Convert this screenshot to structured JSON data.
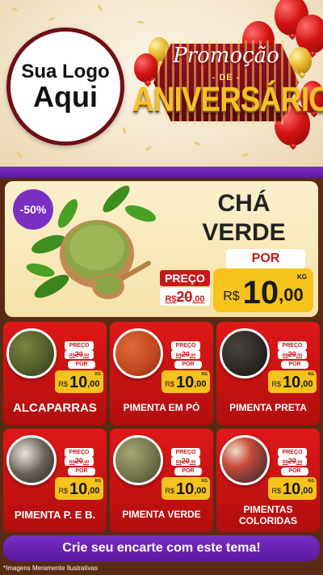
{
  "header": {
    "logo_line1": "Sua Logo",
    "logo_line2": "Aqui",
    "promo_title": "Promoção",
    "promo_de": "- DE -",
    "promo_big": "ANIVERSÁRIO"
  },
  "featured": {
    "badge": "-50%",
    "name_line1": "CHÁ",
    "name_line2": "VERDE",
    "price_label": "PREÇO",
    "por_label": "POR",
    "old_currency": "R$",
    "old_int": "20",
    "old_dec": ",00",
    "new_currency": "R$",
    "new_int": "10",
    "new_dec": ",00",
    "unit": "KG"
  },
  "products": [
    {
      "name": "ALCAPARRAS",
      "price_label": "PREÇO",
      "por_label": "POR",
      "old_currency": "R$",
      "old_int": "20",
      "old_dec": ",00",
      "new_currency": "R$",
      "new_int": "10",
      "new_dec": ",00",
      "unit": "KG",
      "color": "#4f5a2a"
    },
    {
      "name": "PIMENTA EM PÓ",
      "price_label": "PREÇO",
      "por_label": "POR",
      "old_currency": "R$",
      "old_int": "20",
      "old_dec": ",00",
      "new_currency": "R$",
      "new_int": "10",
      "new_dec": ",00",
      "unit": "KG",
      "color": "#c0461e"
    },
    {
      "name": "PIMENTA PRETA",
      "price_label": "PREÇO",
      "por_label": "POR",
      "old_currency": "R$",
      "old_int": "20",
      "old_dec": ",00",
      "new_currency": "R$",
      "new_int": "10",
      "new_dec": ",00",
      "unit": "KG",
      "color": "#2a2622"
    },
    {
      "name": "PIMENTA P. E B.",
      "price_label": "PREÇO",
      "por_label": "POR",
      "old_currency": "R$",
      "old_int": "20",
      "old_dec": ",00",
      "new_currency": "R$",
      "new_int": "10",
      "new_dec": ",00",
      "unit": "KG",
      "color": "#5a5048"
    },
    {
      "name": "PIMENTA VERDE",
      "price_label": "PREÇO",
      "por_label": "POR",
      "old_currency": "R$",
      "old_int": "20",
      "old_dec": ",00",
      "new_currency": "R$",
      "new_int": "10",
      "new_dec": ",00",
      "unit": "KG",
      "color": "#6e7046"
    },
    {
      "name_line1": "PIMENTAS",
      "name_line2": "COLORIDAS",
      "price_label": "PREÇO",
      "por_label": "POR",
      "old_currency": "R$",
      "old_int": "20",
      "old_dec": ",00",
      "new_currency": "R$",
      "new_int": "10",
      "new_dec": ",00",
      "unit": "KG",
      "color": "#7a3a36"
    }
  ],
  "footer": {
    "cta_label": "Crie seu encarte com este tema!",
    "disclaimer": "*Imagens Meramente Ilustrativas"
  },
  "colors": {
    "purple": "#6a22b0",
    "red": "#d01414",
    "yellow": "#f6c21c",
    "brown": "#5a2b14"
  }
}
